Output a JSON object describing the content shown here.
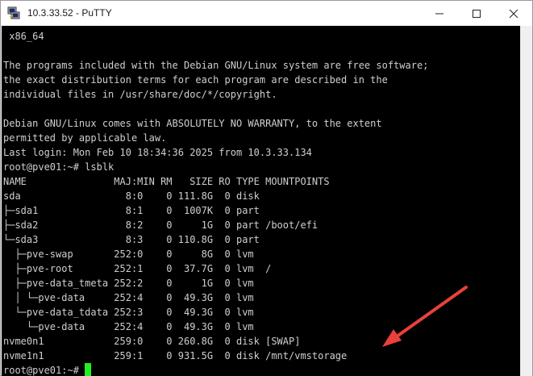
{
  "window": {
    "title": "10.3.33.52 - PuTTY",
    "controls": {
      "minimize": "minimize",
      "maximize": "maximize",
      "close": "close"
    }
  },
  "terminal": {
    "lines": [
      " x86_64",
      "",
      "The programs included with the Debian GNU/Linux system are free software;",
      "the exact distribution terms for each program are described in the",
      "individual files in /usr/share/doc/*/copyright.",
      "",
      "Debian GNU/Linux comes with ABSOLUTELY NO WARRANTY, to the extent",
      "permitted by applicable law.",
      "Last login: Mon Feb 10 18:34:36 2025 from 10.3.33.134",
      "root@pve01:~# lsblk",
      "NAME               MAJ:MIN RM   SIZE RO TYPE MOUNTPOINTS",
      "sda                  8:0    0 111.8G  0 disk",
      "├─sda1               8:1    0  1007K  0 part",
      "├─sda2               8:2    0     1G  0 part /boot/efi",
      "└─sda3               8:3    0 110.8G  0 part",
      "  ├─pve-swap       252:0    0     8G  0 lvm",
      "  ├─pve-root       252:1    0  37.7G  0 lvm  /",
      "  ├─pve-data_tmeta 252:2    0     1G  0 lvm",
      "  │ └─pve-data     252:4    0  49.3G  0 lvm",
      "  └─pve-data_tdata 252:3    0  49.3G  0 lvm",
      "    └─pve-data     252:4    0  49.3G  0 lvm",
      "nvme0n1            259:0    0 260.8G  0 disk [SWAP]",
      "nvme1n1            259:1    0 931.5G  0 disk /mnt/vmstorage"
    ],
    "prompt": "root@pve01:~# ",
    "cursor_color": "#22ee22"
  },
  "annotation": {
    "arrow_color": "#e8413a"
  }
}
